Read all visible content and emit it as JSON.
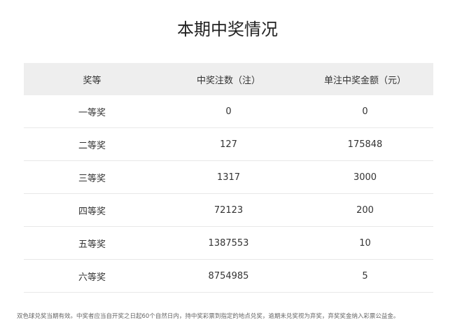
{
  "title": "本期中奖情况",
  "table": {
    "headers": [
      "奖等",
      "中奖注数（注）",
      "单注中奖金额（元）"
    ],
    "rows": [
      {
        "level": "一等奖",
        "count": "0",
        "amount": "0"
      },
      {
        "level": "二等奖",
        "count": "127",
        "amount": "175848"
      },
      {
        "level": "三等奖",
        "count": "1317",
        "amount": "3000"
      },
      {
        "level": "四等奖",
        "count": "72123",
        "amount": "200"
      },
      {
        "level": "五等奖",
        "count": "1387553",
        "amount": "10"
      },
      {
        "level": "六等奖",
        "count": "8754985",
        "amount": "5"
      }
    ]
  },
  "note": "双色球兑奖当期有效。中奖者应当自开奖之日起60个自然日内，持中奖彩票到指定的地点兑奖，逾期未兑奖视为弃奖，弃奖奖金纳入彩票公益金。"
}
